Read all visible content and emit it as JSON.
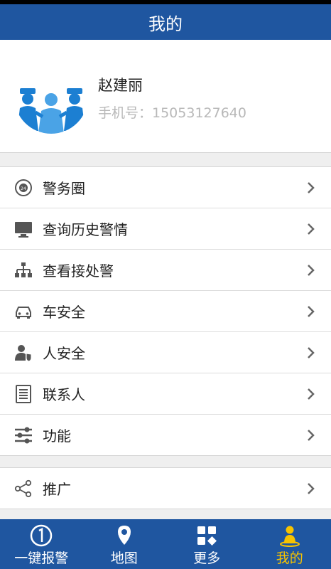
{
  "header": {
    "title": "我的"
  },
  "profile": {
    "name": "赵建丽",
    "phone": "手机号：15053127640"
  },
  "menu_group_1": [
    {
      "label": "警务圈",
      "icon": "police-circle-icon"
    },
    {
      "label": "查询历史警情",
      "icon": "monitor-icon"
    },
    {
      "label": "查看接处警",
      "icon": "org-chart-icon"
    },
    {
      "label": "车安全",
      "icon": "car-icon"
    },
    {
      "label": "人安全",
      "icon": "person-shield-icon"
    },
    {
      "label": "联系人",
      "icon": "contacts-icon"
    },
    {
      "label": "功能",
      "icon": "sliders-icon"
    }
  ],
  "menu_group_2": [
    {
      "label": "推广",
      "icon": "share-icon"
    }
  ],
  "tabbar": [
    {
      "label": "一键报警",
      "icon": "one-key-alarm-icon"
    },
    {
      "label": "地图",
      "icon": "map-pin-icon"
    },
    {
      "label": "更多",
      "icon": "more-grid-icon"
    },
    {
      "label": "我的",
      "icon": "user-icon",
      "active": true
    }
  ],
  "colors": {
    "primary": "#1f56a0",
    "active_tab": "#f7c300",
    "icon_gray": "#555555"
  }
}
